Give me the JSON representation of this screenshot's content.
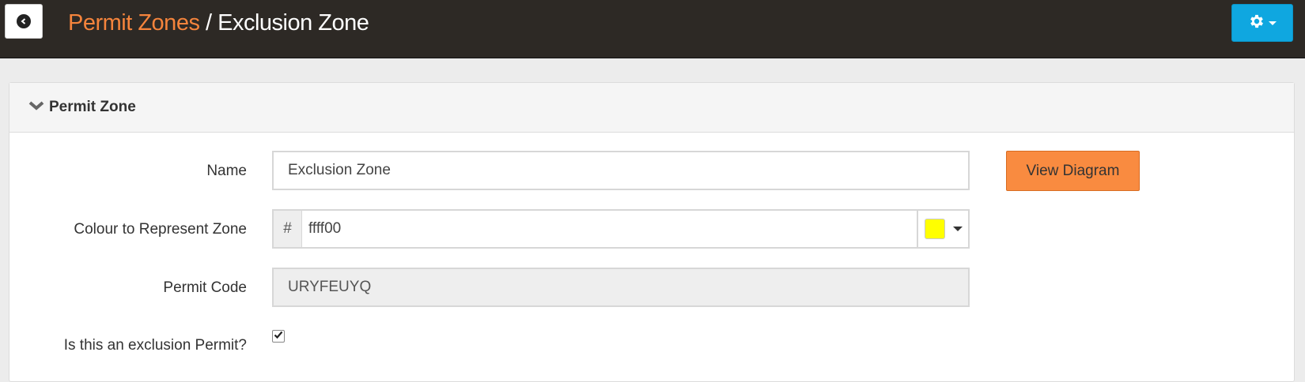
{
  "header": {
    "back_icon": "arrow-left-circle-icon",
    "breadcrumb_parent": "Permit Zones",
    "breadcrumb_separator": " / ",
    "page_title": "Exclusion Zone",
    "settings_icon": "gear-icon",
    "settings_color": "#0fa7e0"
  },
  "panel": {
    "title": "Permit Zone",
    "collapse_icon": "chevron-down-icon"
  },
  "form": {
    "name_label": "Name",
    "name_value": "Exclusion Zone",
    "view_diagram_label": "View Diagram",
    "colour_label": "Colour to Represent Zone",
    "colour_prefix": "#",
    "colour_value": "ffff00",
    "colour_swatch": "#ffff00",
    "permit_code_label": "Permit Code",
    "permit_code_value": "URYFEUYQ",
    "exclusion_label": "Is this an exclusion Permit?",
    "exclusion_checked": true
  },
  "colors": {
    "accent_orange": "#f98b40",
    "breadcrumb_orange": "#f5843c",
    "topbar": "#2d2925"
  }
}
